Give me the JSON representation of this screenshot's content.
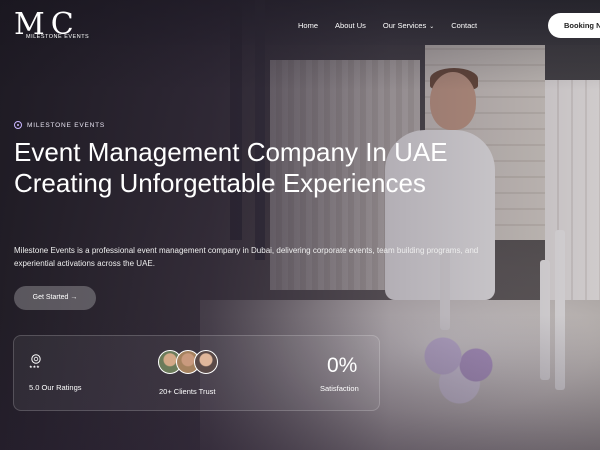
{
  "brand": {
    "logo_mark": "MC",
    "logo_text": "MILESTONE EVENTS"
  },
  "nav": {
    "items": [
      {
        "label": "Home"
      },
      {
        "label": "About Us"
      },
      {
        "label": "Our Services",
        "has_dropdown": true
      },
      {
        "label": "Contact"
      }
    ],
    "book_button": "Booking N"
  },
  "hero": {
    "eyebrow": "MILESTONE EVENTS",
    "title": "Event Management Company In UAE Creating Unforgettable Experiences",
    "description": "Milestone Events is a professional event management company in Dubai, delivering corporate events, team building programs, and experiential activations across the UAE.",
    "cta": "Get Started →"
  },
  "stats": [
    {
      "label": "5.0 Our Ratings",
      "icon": "rating-badge-icon"
    },
    {
      "label": "20+ Clients Trust",
      "icon": "client-avatars"
    },
    {
      "value": "0%",
      "label": "Satisfaction"
    }
  ],
  "colors": {
    "accent": "#c9b6ff",
    "button_bg": "#ffffff",
    "overlay": "#2a2232"
  }
}
